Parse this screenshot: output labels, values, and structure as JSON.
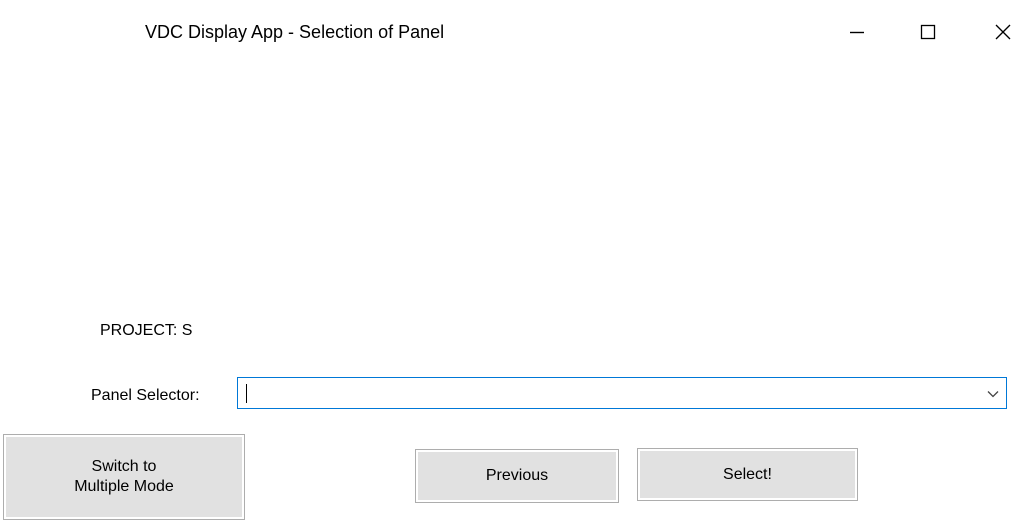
{
  "window": {
    "title": "VDC Display App - Selection of Panel",
    "controls": {
      "minimize_icon": "minimize-icon",
      "maximize_icon": "maximize-icon",
      "close_icon": "close-icon"
    }
  },
  "form": {
    "project_label": "PROJECT: S",
    "panel_selector_label": "Panel Selector:",
    "panel_selector_value": "",
    "panel_selector_icon": "chevron-down-icon"
  },
  "buttons": {
    "switch_line1": "Switch to",
    "switch_line2": "Multiple Mode",
    "previous": "Previous",
    "select": "Select!"
  },
  "colors": {
    "focus_border": "#0078d7",
    "button_face": "#e1e1e1",
    "button_border": "#adadad"
  }
}
